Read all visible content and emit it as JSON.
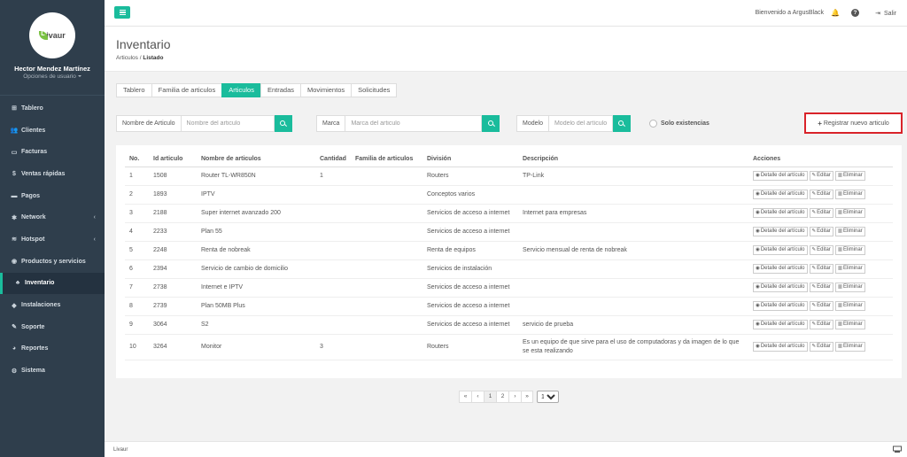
{
  "sidebar": {
    "logo_text": "Livaur",
    "logo_letter": "L",
    "logo_rest": "ivaur",
    "user_name": "Hector Mendez Martínez",
    "user_options": "Opciones de usuario",
    "items": [
      {
        "label": "Tablero",
        "icon": "⊞"
      },
      {
        "label": "Clientes",
        "icon": "👥"
      },
      {
        "label": "Facturas",
        "icon": "▭"
      },
      {
        "label": "Ventas rápidas",
        "icon": "$"
      },
      {
        "label": "Pagos",
        "icon": "▬"
      },
      {
        "label": "Network",
        "icon": "✱"
      },
      {
        "label": "Hotspot",
        "icon": "≋"
      },
      {
        "label": "Productos y servicios",
        "icon": "◉"
      },
      {
        "label": "Inventario",
        "icon": "♣"
      },
      {
        "label": "Instalaciones",
        "icon": "◆"
      },
      {
        "label": "Soporte",
        "icon": "✎"
      },
      {
        "label": "Reportes",
        "icon": "◕"
      },
      {
        "label": "Sistema",
        "icon": "⚙"
      }
    ],
    "chevron": "‹"
  },
  "topbar": {
    "welcome": "Bienvenido a ArgusBlack",
    "bell_icon": "🔔",
    "help_icon": "?",
    "logout_icon": "⇥",
    "logout": "Salir"
  },
  "header": {
    "title": "Inventario",
    "breadcrumb_parent": "Articulos",
    "breadcrumb_sep": "/",
    "breadcrumb_current": "Listado"
  },
  "tabs": [
    "Tablero",
    "Familia de articulos",
    "Articulos",
    "Entradas",
    "Movimientos",
    "Solicitudes"
  ],
  "filters": {
    "name_label": "Nombre de Articulo",
    "name_placeholder": "Nombre del articulo",
    "brand_label": "Marca",
    "brand_placeholder": "Marca del articulo",
    "model_label": "Modelo",
    "model_placeholder": "Modelo del artículo",
    "stock_label": "Solo existencias",
    "register_label": "Registrar nuevo articulo",
    "register_icon": "+"
  },
  "table": {
    "headers": [
      "No.",
      "Id articulo",
      "Nombre de articulos",
      "Cantidad",
      "Familia de articulos",
      "División",
      "Descripción",
      "Acciones"
    ],
    "action_labels": {
      "detail": "Detalle del artículo",
      "edit": "Editar",
      "delete": "Eliminar"
    },
    "action_icons": {
      "detail": "◉",
      "edit": "✎",
      "delete": "▥"
    },
    "rows": [
      {
        "no": "1",
        "id": "1508",
        "name": "Router TL-WR850N",
        "qty": "1",
        "family": "",
        "division": "Routers",
        "desc": "TP-Link"
      },
      {
        "no": "2",
        "id": "1893",
        "name": "IPTV",
        "qty": "",
        "family": "",
        "division": "Conceptos varios",
        "desc": ""
      },
      {
        "no": "3",
        "id": "2188",
        "name": "Super internet avanzado 200",
        "qty": "",
        "family": "",
        "division": "Servicios de acceso a internet",
        "desc": "Internet para empresas"
      },
      {
        "no": "4",
        "id": "2233",
        "name": "Plan 55",
        "qty": "",
        "family": "",
        "division": "Servicios de acceso a internet",
        "desc": ""
      },
      {
        "no": "5",
        "id": "2248",
        "name": "Renta de nobreak",
        "qty": "",
        "family": "",
        "division": "Renta de equipos",
        "desc": "Servicio mensual de renta de nobreak"
      },
      {
        "no": "6",
        "id": "2394",
        "name": "Servicio de cambio de domicilio",
        "qty": "",
        "family": "",
        "division": "Servicios de instalación",
        "desc": ""
      },
      {
        "no": "7",
        "id": "2738",
        "name": "Internet e IPTV",
        "qty": "",
        "family": "",
        "division": "Servicios de acceso a internet",
        "desc": ""
      },
      {
        "no": "8",
        "id": "2739",
        "name": "Plan 50MB Plus",
        "qty": "",
        "family": "",
        "division": "Servicios de acceso a internet",
        "desc": ""
      },
      {
        "no": "9",
        "id": "3064",
        "name": "S2",
        "qty": "",
        "family": "",
        "division": "Servicios de acceso a internet",
        "desc": "servicio de prueba"
      },
      {
        "no": "10",
        "id": "3264",
        "name": "Monitor",
        "qty": "3",
        "family": "",
        "division": "Routers",
        "desc": "Es un equipo de que sirve para el uso de computadoras y da imagen de lo que se esta realizando"
      }
    ]
  },
  "pagination": {
    "first": "«",
    "prev": "‹",
    "pages": [
      "1",
      "2"
    ],
    "next": "›",
    "last": "»",
    "per_page": "10"
  },
  "footer": {
    "text": "Livaur"
  },
  "colors": {
    "accent": "#1abc9c",
    "sidebar_bg": "#2f3e4c",
    "highlight_border": "#d9232a"
  }
}
